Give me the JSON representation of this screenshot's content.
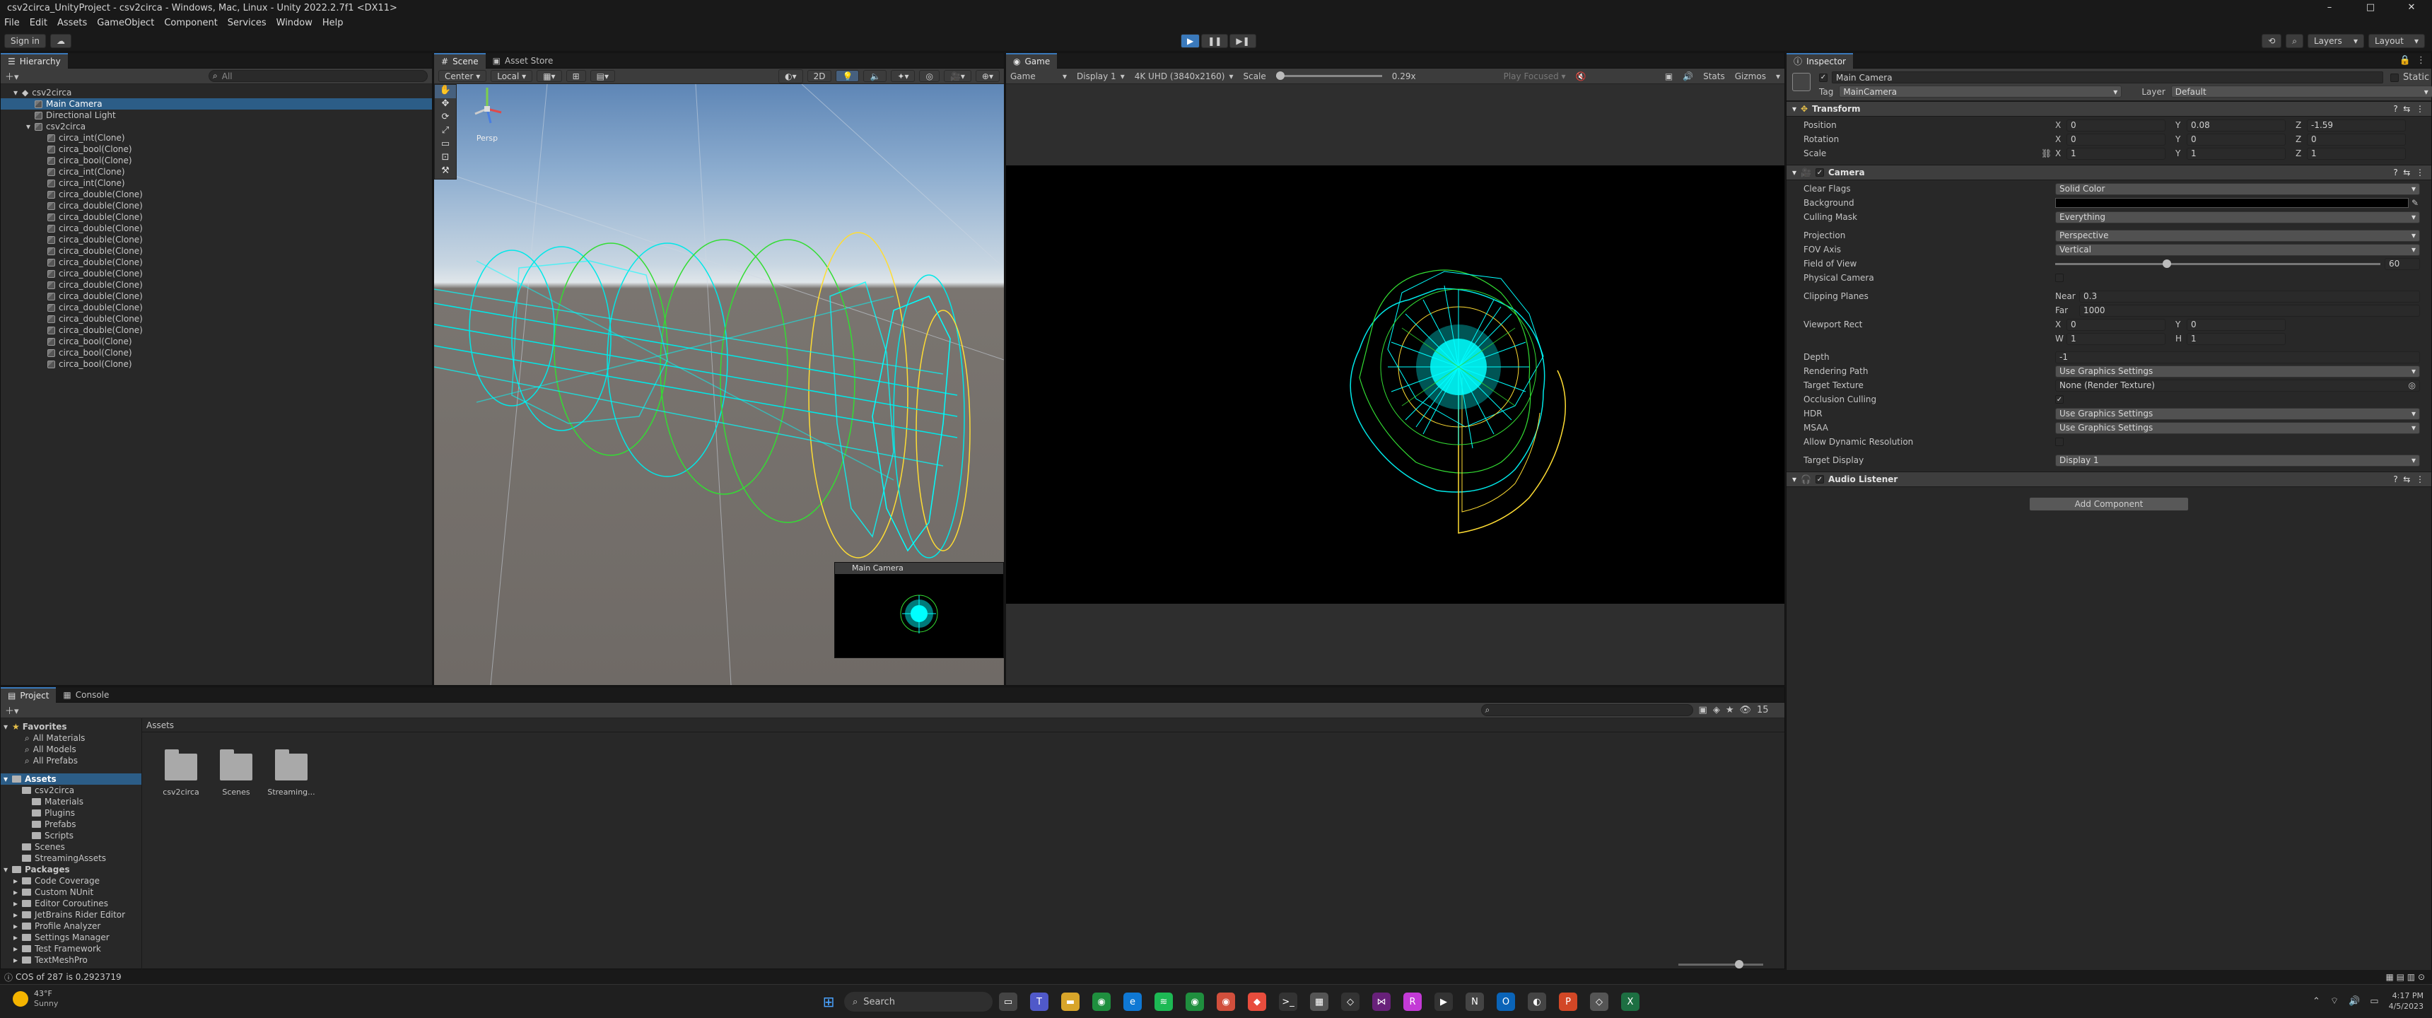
{
  "window": {
    "title": "csv2circa_UnityProject - csv2circa - Windows, Mac, Linux - Unity 2022.2.7f1 <DX11>",
    "controls": [
      "–",
      "□",
      "✕"
    ]
  },
  "menu": [
    "File",
    "Edit",
    "Assets",
    "GameObject",
    "Component",
    "Services",
    "Window",
    "Help"
  ],
  "toolbar": {
    "sign_in": "Sign in",
    "cloud": "☁",
    "play": "▶",
    "pause": "❚❚",
    "step": "▶❚",
    "layers": "Layers",
    "layout": "Layout"
  },
  "hierarchy": {
    "tab": "Hierarchy",
    "search_placeholder": "All",
    "scene": "csv2circa",
    "items": [
      {
        "label": "Main Camera",
        "indent": 1,
        "selected": true
      },
      {
        "label": "Directional Light",
        "indent": 1
      },
      {
        "label": "csv2circa",
        "indent": 1,
        "foldout": true
      },
      {
        "label": "circa_int(Clone)",
        "indent": 2
      },
      {
        "label": "circa_bool(Clone)",
        "indent": 2
      },
      {
        "label": "circa_bool(Clone)",
        "indent": 2
      },
      {
        "label": "circa_int(Clone)",
        "indent": 2
      },
      {
        "label": "circa_int(Clone)",
        "indent": 2
      },
      {
        "label": "circa_double(Clone)",
        "indent": 2
      },
      {
        "label": "circa_double(Clone)",
        "indent": 2
      },
      {
        "label": "circa_double(Clone)",
        "indent": 2
      },
      {
        "label": "circa_double(Clone)",
        "indent": 2
      },
      {
        "label": "circa_double(Clone)",
        "indent": 2
      },
      {
        "label": "circa_double(Clone)",
        "indent": 2
      },
      {
        "label": "circa_double(Clone)",
        "indent": 2
      },
      {
        "label": "circa_double(Clone)",
        "indent": 2
      },
      {
        "label": "circa_double(Clone)",
        "indent": 2
      },
      {
        "label": "circa_double(Clone)",
        "indent": 2
      },
      {
        "label": "circa_double(Clone)",
        "indent": 2
      },
      {
        "label": "circa_double(Clone)",
        "indent": 2
      },
      {
        "label": "circa_double(Clone)",
        "indent": 2
      },
      {
        "label": "circa_bool(Clone)",
        "indent": 2
      },
      {
        "label": "circa_bool(Clone)",
        "indent": 2
      },
      {
        "label": "circa_bool(Clone)",
        "indent": 2
      }
    ]
  },
  "scene": {
    "tabs": [
      "Scene",
      "Asset Store"
    ],
    "pivot": "Center",
    "space": "Local",
    "persp_label": "Persp",
    "camera_preview_title": "Main Camera"
  },
  "game": {
    "tab": "Game",
    "mode": "Game",
    "display": "Display 1",
    "resolution": "4K UHD (3840x2160)",
    "scale_label": "Scale",
    "scale_value": "0.29x",
    "play_focused": "Play Focused",
    "stats": "Stats",
    "gizmos": "Gizmos"
  },
  "inspector": {
    "tab": "Inspector",
    "object_name": "Main Camera",
    "static_label": "Static",
    "tag_label": "Tag",
    "tag": "MainCamera",
    "layer_label": "Layer",
    "layer": "Default",
    "transform": {
      "title": "Transform",
      "position": {
        "label": "Position",
        "x": "0",
        "y": "0.08",
        "z": "-1.59"
      },
      "rotation": {
        "label": "Rotation",
        "x": "0",
        "y": "0",
        "z": "0"
      },
      "scale": {
        "label": "Scale",
        "x": "1",
        "y": "1",
        "z": "1"
      }
    },
    "camera": {
      "title": "Camera",
      "clear_flags": {
        "label": "Clear Flags",
        "value": "Solid Color"
      },
      "background": {
        "label": "Background"
      },
      "culling_mask": {
        "label": "Culling Mask",
        "value": "Everything"
      },
      "projection": {
        "label": "Projection",
        "value": "Perspective"
      },
      "fov_axis": {
        "label": "FOV Axis",
        "value": "Vertical"
      },
      "field_of_view": {
        "label": "Field of View",
        "value": "60"
      },
      "physical_camera": {
        "label": "Physical Camera"
      },
      "clipping_planes": {
        "label": "Clipping Planes",
        "near_label": "Near",
        "near": "0.3",
        "far_label": "Far",
        "far": "1000"
      },
      "viewport_rect": {
        "label": "Viewport Rect",
        "x": "0",
        "y": "0",
        "w": "1",
        "h": "1"
      },
      "depth": {
        "label": "Depth",
        "value": "-1"
      },
      "rendering_path": {
        "label": "Rendering Path",
        "value": "Use Graphics Settings"
      },
      "target_texture": {
        "label": "Target Texture",
        "value": "None (Render Texture)"
      },
      "occlusion_culling": {
        "label": "Occlusion Culling"
      },
      "hdr": {
        "label": "HDR",
        "value": "Use Graphics Settings"
      },
      "msaa": {
        "label": "MSAA",
        "value": "Use Graphics Settings"
      },
      "allow_dynamic_resolution": {
        "label": "Allow Dynamic Resolution"
      },
      "target_display": {
        "label": "Target Display",
        "value": "Display 1"
      }
    },
    "audio_listener": {
      "title": "Audio Listener"
    },
    "add_component": "Add Component"
  },
  "project": {
    "tabs": [
      "Project",
      "Console"
    ],
    "favorites_label": "Favorites",
    "favorites": [
      "All Materials",
      "All Models",
      "All Prefabs"
    ],
    "assets_label": "Assets",
    "assets_tree": [
      {
        "label": "csv2circa",
        "indent": 1
      },
      {
        "label": "Materials",
        "indent": 2
      },
      {
        "label": "Plugins",
        "indent": 2
      },
      {
        "label": "Prefabs",
        "indent": 2
      },
      {
        "label": "Scripts",
        "indent": 2
      },
      {
        "label": "Scenes",
        "indent": 1
      },
      {
        "label": "StreamingAssets",
        "indent": 1
      }
    ],
    "packages_label": "Packages",
    "packages": [
      "Code Coverage",
      "Custom NUnit",
      "Editor Coroutines",
      "JetBrains Rider Editor",
      "Profile Analyzer",
      "Settings Manager",
      "Test Framework",
      "TextMeshPro"
    ],
    "breadcrumb": "Assets",
    "grid_items": [
      "csv2circa",
      "Scenes",
      "Streaming..."
    ],
    "asset_count": "15"
  },
  "status_bar": {
    "message": "COS of 287 is 0.2923719"
  },
  "taskbar": {
    "weather_temp": "43°F",
    "weather_desc": "Sunny",
    "search": "Search",
    "time": "4:17 PM",
    "date": "4/5/2023"
  },
  "colors": {
    "accent_blue": "#3a79bb",
    "selection": "#2c5d87",
    "viz_cyan": "#00ffff",
    "viz_green": "#33ff33",
    "viz_yellow": "#ffdd33"
  }
}
